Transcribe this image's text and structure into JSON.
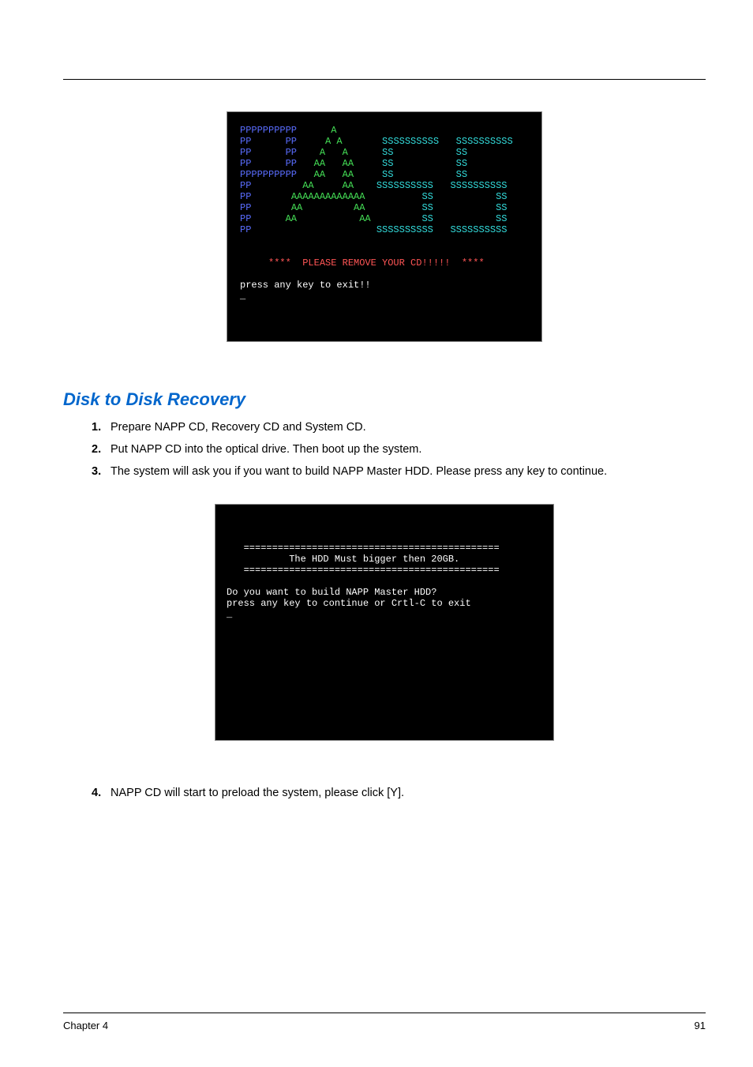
{
  "console1": {
    "lines": [
      {
        "segs": [
          {
            "c": "cblue",
            "t": "PPPPPPPPPP      "
          },
          {
            "c": "cgreen",
            "t": "A"
          }
        ]
      },
      {
        "segs": [
          {
            "c": "cblue",
            "t": "PP      PP     "
          },
          {
            "c": "cgreen",
            "t": "A A       "
          },
          {
            "c": "ccyan",
            "t": "SSSSSSSSSS   SSSSSSSSSS"
          }
        ]
      },
      {
        "segs": [
          {
            "c": "cblue",
            "t": "PP      PP    "
          },
          {
            "c": "cgreen",
            "t": "A   A      "
          },
          {
            "c": "ccyan",
            "t": "SS           SS"
          }
        ]
      },
      {
        "segs": [
          {
            "c": "cblue",
            "t": "PP      PP   "
          },
          {
            "c": "cgreen",
            "t": "AA   AA     "
          },
          {
            "c": "ccyan",
            "t": "SS           SS"
          }
        ]
      },
      {
        "segs": [
          {
            "c": "cblue",
            "t": "PPPPPPPPPP   "
          },
          {
            "c": "cgreen",
            "t": "AA   AA     "
          },
          {
            "c": "ccyan",
            "t": "SS           SS"
          }
        ]
      },
      {
        "segs": [
          {
            "c": "cblue",
            "t": "PP         "
          },
          {
            "c": "cgreen",
            "t": "AA     AA    "
          },
          {
            "c": "ccyan",
            "t": "SSSSSSSSSS   SSSSSSSSSS"
          }
        ]
      },
      {
        "segs": [
          {
            "c": "cblue",
            "t": "PP       "
          },
          {
            "c": "cgreen",
            "t": "AAAAAAAAAAAAA          "
          },
          {
            "c": "ccyan",
            "t": "SS           SS"
          }
        ]
      },
      {
        "segs": [
          {
            "c": "cblue",
            "t": "PP       "
          },
          {
            "c": "cgreen",
            "t": "AA         AA          "
          },
          {
            "c": "ccyan",
            "t": "SS           SS"
          }
        ]
      },
      {
        "segs": [
          {
            "c": "cblue",
            "t": "PP      "
          },
          {
            "c": "cgreen",
            "t": "AA           AA         "
          },
          {
            "c": "ccyan",
            "t": "SS           SS"
          }
        ]
      },
      {
        "segs": [
          {
            "c": "cblue",
            "t": "PP                      "
          },
          {
            "c": "ccyan",
            "t": "SSSSSSSSSS   SSSSSSSSSS"
          }
        ]
      },
      {
        "segs": [
          {
            "c": "cwhite",
            "t": ""
          }
        ]
      },
      {
        "segs": [
          {
            "c": "cwhite",
            "t": ""
          }
        ]
      },
      {
        "segs": [
          {
            "c": "cred",
            "t": "     ****  PLEASE REMOVE YOUR CD!!!!!  ****"
          }
        ]
      },
      {
        "segs": [
          {
            "c": "cwhite",
            "t": ""
          }
        ]
      },
      {
        "segs": [
          {
            "c": "cwhite",
            "t": "press any key to exit!!"
          }
        ]
      },
      {
        "segs": [
          {
            "c": "cwhite",
            "t": "_"
          }
        ]
      }
    ]
  },
  "section_title": "Disk to Disk Recovery",
  "stepsA": [
    {
      "n": "1.",
      "t": "Prepare NAPP CD, Recovery CD and System CD."
    },
    {
      "n": "2.",
      "t": "Put NAPP CD into the optical drive. Then boot up the system."
    },
    {
      "n": "3.",
      "t": "The system will ask you if you want to build NAPP Master HDD. Please press any key to continue."
    }
  ],
  "console2": {
    "lines": [
      "",
      "",
      "   =============================================",
      "           The HDD Must bigger then 20GB.",
      "   =============================================",
      "",
      "Do you want to build NAPP Master HDD?",
      "press any key to continue or Crtl-C to exit",
      "_"
    ]
  },
  "stepsB": [
    {
      "n": "4.",
      "t": "NAPP CD will start to preload the system, please click [Y]."
    }
  ],
  "footer": {
    "left": "Chapter 4",
    "right": "91"
  }
}
